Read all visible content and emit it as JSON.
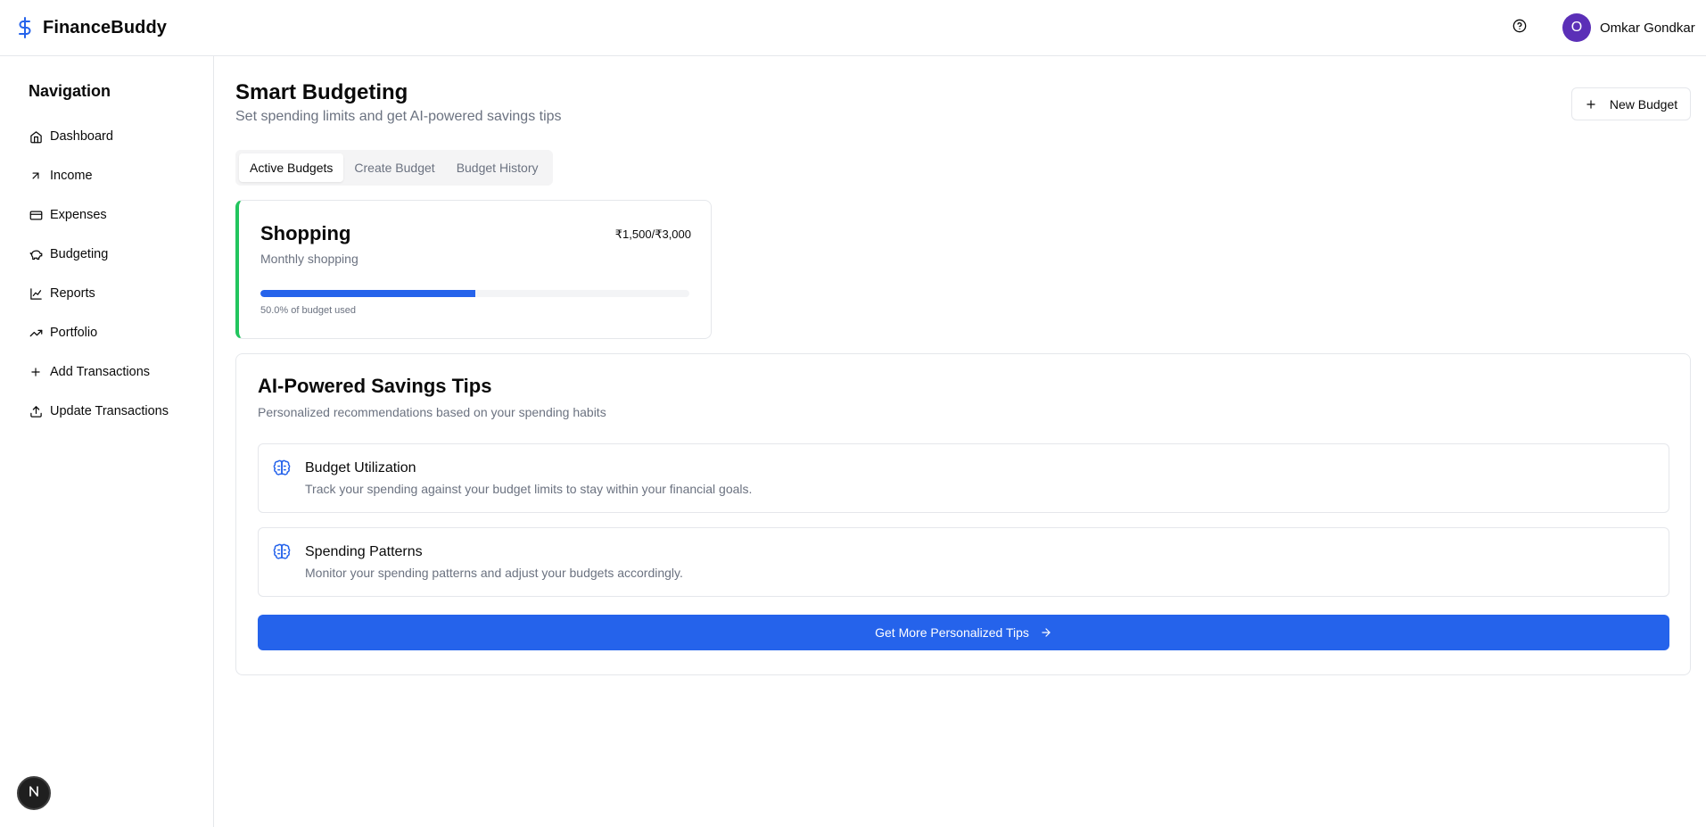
{
  "header": {
    "brand_name": "FinanceBuddy",
    "user_initial": "O",
    "user_name": "Omkar Gondkar"
  },
  "sidebar": {
    "title": "Navigation",
    "items": [
      {
        "label": "Dashboard",
        "icon": "home-icon"
      },
      {
        "label": "Income",
        "icon": "arrow-up-right-icon"
      },
      {
        "label": "Expenses",
        "icon": "credit-card-icon"
      },
      {
        "label": "Budgeting",
        "icon": "piggy-bank-icon"
      },
      {
        "label": "Reports",
        "icon": "line-chart-icon"
      },
      {
        "label": "Portfolio",
        "icon": "trending-up-icon"
      },
      {
        "label": "Add Transactions",
        "icon": "plus-icon"
      },
      {
        "label": "Update Transactions",
        "icon": "upload-icon"
      }
    ],
    "badge_letter": "N"
  },
  "main": {
    "title": "Smart Budgeting",
    "subtitle": "Set spending limits and get AI-powered savings tips",
    "new_budget_label": "New Budget",
    "tabs": [
      {
        "label": "Active Budgets",
        "active": true
      },
      {
        "label": "Create Budget",
        "active": false
      },
      {
        "label": "Budget History",
        "active": false
      }
    ],
    "budget": {
      "name": "Shopping",
      "description": "Monthly shopping",
      "amount": "₹1,500/₹3,000",
      "used_fraction": 0.5,
      "used_text": "50.0% of budget used",
      "accent_color": "#22c55e"
    },
    "tips": {
      "title": "AI-Powered Savings Tips",
      "subtitle": "Personalized recommendations based on your spending habits",
      "items": [
        {
          "title": "Budget Utilization",
          "text": "Track your spending against your budget limits to stay within your financial goals.",
          "icon": "brain-icon"
        },
        {
          "title": "Spending Patterns",
          "text": "Monitor your spending patterns and adjust your budgets accordingly.",
          "icon": "brain-icon"
        }
      ],
      "button_label": "Get More Personalized Tips"
    }
  },
  "colors": {
    "primary": "#2563eb",
    "avatar": "#5b2fb7",
    "success": "#22c55e"
  }
}
